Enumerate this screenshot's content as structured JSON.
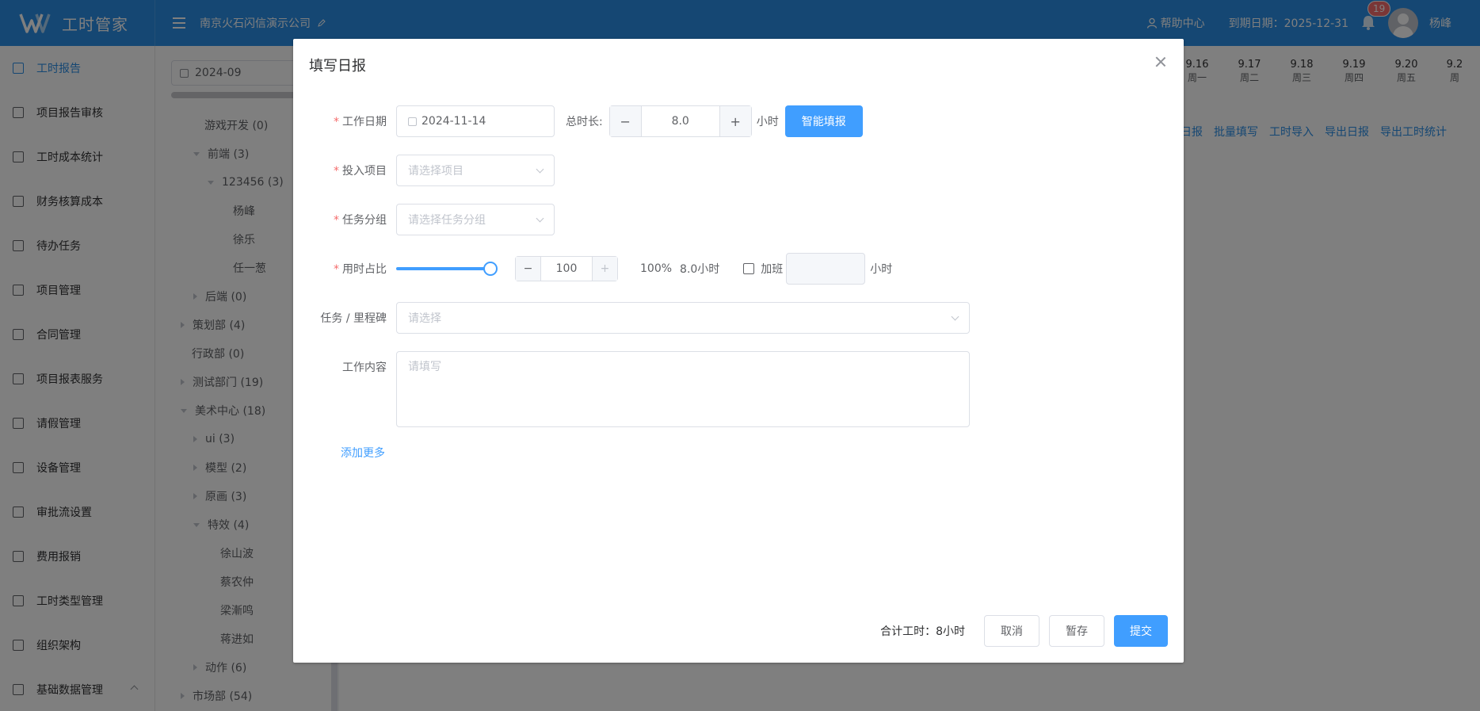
{
  "header": {
    "app_name": "工时管家",
    "company": "南京火石闪信演示公司",
    "help": "帮助中心",
    "expire": "到期日期：2025-12-31",
    "notification_count": "19",
    "user": "杨峰"
  },
  "sidebar": {
    "items": [
      {
        "label": "工时报告"
      },
      {
        "label": "项目报告审核"
      },
      {
        "label": "工时成本统计"
      },
      {
        "label": "财务核算成本"
      },
      {
        "label": "待办任务"
      },
      {
        "label": "项目管理"
      },
      {
        "label": "合同管理"
      },
      {
        "label": "项目报表服务"
      },
      {
        "label": "请假管理"
      },
      {
        "label": "设备管理"
      },
      {
        "label": "审批流设置"
      },
      {
        "label": "费用报销"
      },
      {
        "label": "工时类型管理"
      },
      {
        "label": "组织架构"
      },
      {
        "label": "基础数据管理"
      }
    ]
  },
  "tree": {
    "month": "2024-09",
    "nodes": [
      {
        "label": "游戏开发 (0)"
      },
      {
        "label": "前端 (3)"
      },
      {
        "label": "123456 (3)"
      },
      {
        "label": "杨峰"
      },
      {
        "label": "徐乐"
      },
      {
        "label": "任一葱"
      },
      {
        "label": "后端 (0)"
      },
      {
        "label": "策划部 (4)"
      },
      {
        "label": "行政部 (0)"
      },
      {
        "label": "测试部门 (19)"
      },
      {
        "label": "美术中心 (18)"
      },
      {
        "label": "ui (3)"
      },
      {
        "label": "模型 (2)"
      },
      {
        "label": "原画 (3)"
      },
      {
        "label": "特效 (4)"
      },
      {
        "label": "徐山波"
      },
      {
        "label": "蔡农仲"
      },
      {
        "label": "梁漸鸣"
      },
      {
        "label": "蒋进如"
      },
      {
        "label": "动作 (6)"
      },
      {
        "label": "市场部 (54)"
      }
    ]
  },
  "calendar": {
    "days": [
      {
        "date": "9.16",
        "week": "周一"
      },
      {
        "date": "9.17",
        "week": "周二"
      },
      {
        "date": "9.18",
        "week": "周三"
      },
      {
        "date": "9.19",
        "week": "周四"
      },
      {
        "date": "9.20",
        "week": "周五"
      },
      {
        "date": "9.2",
        "week": "周"
      }
    ],
    "actions": [
      "日报",
      "批量填写",
      "工时导入",
      "导出日报",
      "导出工时统计"
    ]
  },
  "dialog": {
    "title": "填写日报",
    "work_date_label": "工作日期",
    "work_date": "2024-11-14",
    "total_label": "总时长:",
    "total_value": "8.0",
    "hours_unit": "小时",
    "smart_fill": "智能填报",
    "project_label": "投入项目",
    "project_placeholder": "请选择项目",
    "group_label": "任务分组",
    "group_placeholder": "请选择任务分组",
    "ratio_label": "用时占比",
    "ratio_fraction": 1.0,
    "ratio_value": "100",
    "ratio_percent": "100%",
    "ratio_hours": "8.0小时",
    "overtime_label": "加班",
    "overtime_unit": "小时",
    "task_label": "任务 / 里程碑",
    "task_placeholder": "请选择",
    "content_label": "工作内容",
    "content_placeholder": "请填写",
    "add_more": "添加更多",
    "total_hours": "合计工时：8小时",
    "cancel": "取消",
    "save_draft": "暂存",
    "submit": "提交"
  }
}
